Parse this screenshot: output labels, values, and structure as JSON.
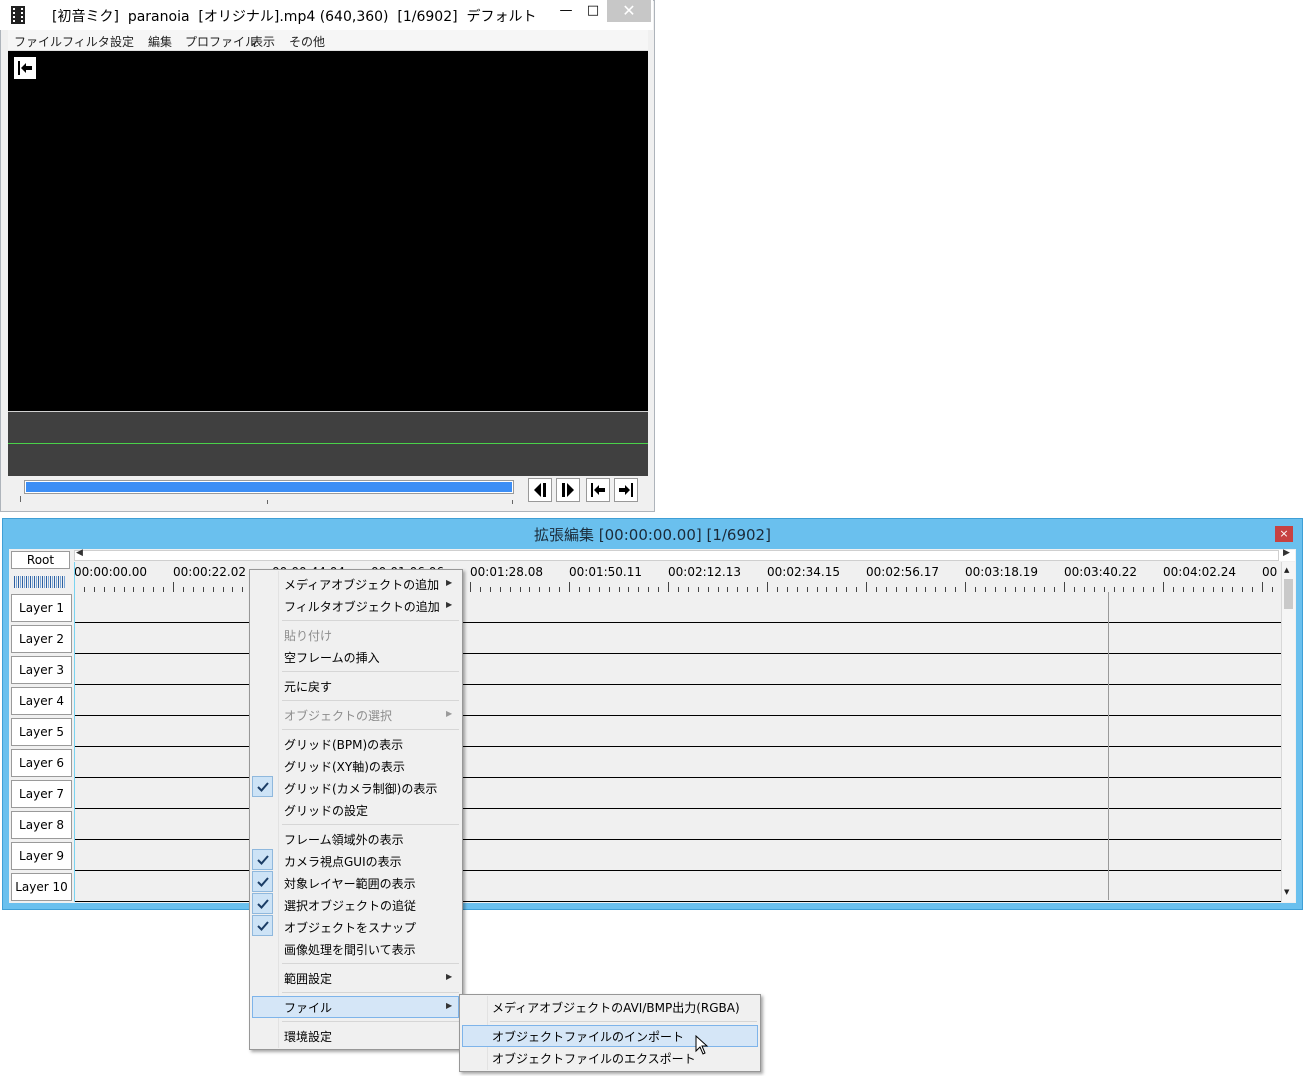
{
  "main_window": {
    "title": "[初音ミク]  paranoia  [オリジナル].mp4 (640,360)  [1/6902]  デフォルト",
    "controls": {
      "minimize": "—",
      "maximize": "□",
      "close": "✕"
    },
    "menu": [
      "ファイル",
      "フィルタ",
      "設定",
      "編集",
      "プロファイル",
      "表示",
      "その他"
    ],
    "icons": {
      "app": "film-icon",
      "preview_corner": "jump-to-start-icon",
      "nav": [
        "previous-frame-icon",
        "next-frame-icon",
        "first-frame-icon",
        "last-frame-icon"
      ]
    },
    "seek_position": 1.0
  },
  "ext_window": {
    "title": "拡張編集 [00:00:00.00] [1/6902]",
    "close": "×",
    "root_label": "Root",
    "timeline_labels": [
      "00:00:00.00",
      "00:00:22.02",
      "00:00:44.04",
      "00:01:06.06",
      "00:01:28.08",
      "00:01:50.11",
      "00:02:12.13",
      "00:02:34.15",
      "00:02:56.17",
      "00:03:18.19",
      "00:03:40.22",
      "00:04:02.24",
      "00"
    ],
    "layers": [
      "Layer  1",
      "Layer  2",
      "Layer  3",
      "Layer  4",
      "Layer  5",
      "Layer  6",
      "Layer  7",
      "Layer  8",
      "Layer  9",
      "Layer 10"
    ]
  },
  "context_menu": {
    "items": [
      {
        "label": "メディアオブジェクトの追加",
        "submenu": true
      },
      {
        "label": "フィルタオブジェクトの追加",
        "submenu": true
      },
      {
        "label": "貼り付け",
        "disabled": true
      },
      {
        "label": "空フレームの挿入"
      },
      {
        "label": "元に戻す"
      },
      {
        "label": "オブジェクトの選択",
        "submenu": true,
        "disabled": true
      },
      {
        "label": "グリッド(BPM)の表示"
      },
      {
        "label": "グリッド(XY軸)の表示"
      },
      {
        "label": "グリッド(カメラ制御)の表示",
        "checked": true
      },
      {
        "label": "グリッドの設定"
      },
      {
        "label": "フレーム領域外の表示"
      },
      {
        "label": "カメラ視点GUIの表示",
        "checked": true
      },
      {
        "label": "対象レイヤー範囲の表示",
        "checked": true
      },
      {
        "label": "選択オブジェクトの追従",
        "checked": true
      },
      {
        "label": "オブジェクトをスナップ",
        "checked": true
      },
      {
        "label": "画像処理を間引いて表示"
      },
      {
        "label": "範囲設定",
        "submenu": true
      },
      {
        "label": "ファイル",
        "submenu": true,
        "highlighted": true
      },
      {
        "label": "環境設定"
      }
    ]
  },
  "file_submenu": {
    "items": [
      {
        "label": "メディアオブジェクトのAVI/BMP出力(RGBA)"
      },
      {
        "label": "オブジェクトファイルのインポート",
        "highlighted": true
      },
      {
        "label": "オブジェクトファイルのエクスポート"
      }
    ]
  },
  "colors": {
    "ext_title_bar": "#6ac0ee",
    "seek_fill": "#3c8ef5",
    "audio_line": "#4ad24a",
    "menu_highlight": "#d5e6f7"
  }
}
